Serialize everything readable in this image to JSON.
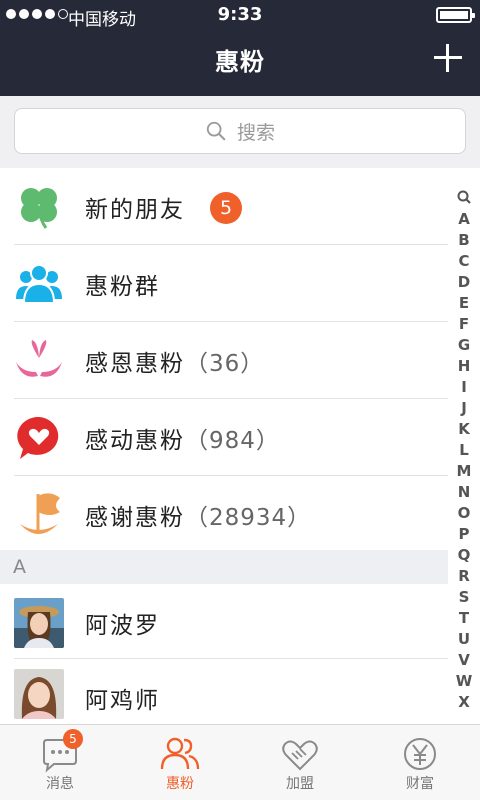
{
  "status_bar": {
    "carrier": "中国移动",
    "time": "9:33"
  },
  "header": {
    "title": "惠粉"
  },
  "search": {
    "placeholder": "搜索"
  },
  "rows": [
    {
      "name": "新的朋友",
      "badge": "5"
    },
    {
      "name": "惠粉群"
    },
    {
      "name": "感恩惠粉",
      "count": "（36）"
    },
    {
      "name": "感动惠粉",
      "count": "（984）"
    },
    {
      "name": "感谢惠粉",
      "count": "（28934）"
    }
  ],
  "section": {
    "label": "A"
  },
  "contacts": [
    {
      "name": "阿波罗"
    },
    {
      "name": "阿鸡师"
    }
  ],
  "index": [
    "A",
    "B",
    "C",
    "D",
    "E",
    "F",
    "G",
    "H",
    "I",
    "J",
    "K",
    "L",
    "M",
    "N",
    "O",
    "P",
    "Q",
    "R",
    "S",
    "T",
    "U",
    "V",
    "W",
    "X"
  ],
  "tabs": [
    {
      "label": "消息",
      "badge": "5"
    },
    {
      "label": "惠粉"
    },
    {
      "label": "加盟"
    },
    {
      "label": "财富"
    }
  ],
  "colors": {
    "accent": "#f0602a",
    "header_bg": "#262a38",
    "icon_blue": "#1ab0e8",
    "icon_green": "#5dba6e",
    "icon_pink": "#e8679a",
    "icon_red": "#e02c2c"
  }
}
